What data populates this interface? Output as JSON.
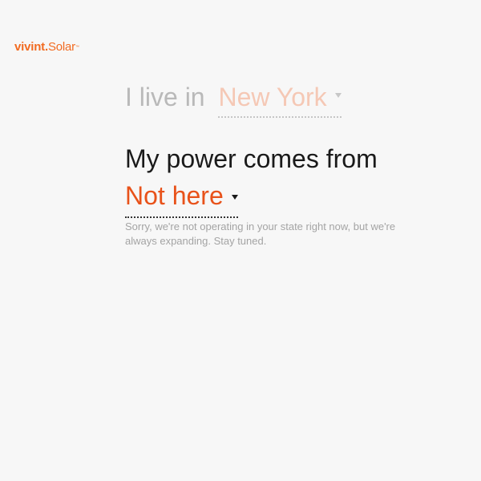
{
  "brand": {
    "name": "vivint",
    "dot": ".",
    "product": "Solar",
    "trademark": "™",
    "accent_color": "#f26b21"
  },
  "location_question": {
    "prefix": "I live in",
    "selected_state": "New York"
  },
  "power_question": {
    "prefix": "My power comes from",
    "selected_source": "Not here"
  },
  "message": {
    "text": "Sorry, we're not operating in your state right now, but we're always expanding. Stay tuned."
  },
  "icons": {
    "dropdown": "chevron-down-icon"
  },
  "colors": {
    "background": "#f7f7f7",
    "selected_answer": "#e8521a",
    "muted_text": "#b9b9b9",
    "muted_selection": "#f5c8b5",
    "body_text": "#1a1a1a"
  }
}
